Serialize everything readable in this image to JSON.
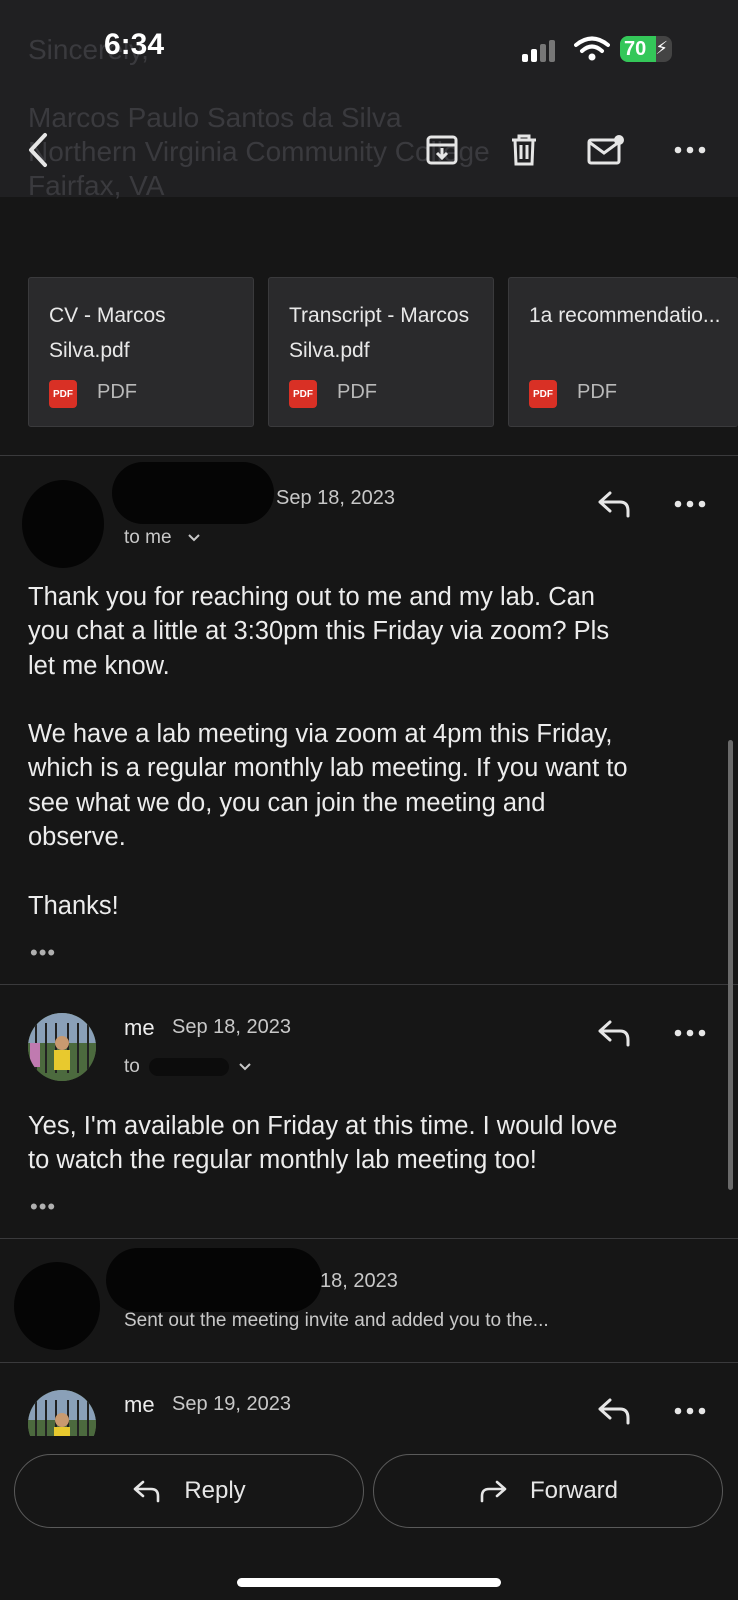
{
  "status_bar": {
    "time": "6:34",
    "battery": "70",
    "battery_level": 0.7
  },
  "header_ghost": {
    "line1": "Sincerely,",
    "line2": "Marcos Paulo Santos da Silva",
    "line3": "Northern Virginia Community College",
    "line4": "Fairfax, VA"
  },
  "toolbar": {
    "icons": [
      "back-icon",
      "archive-icon",
      "trash-icon",
      "mark-unread-icon",
      "more-icon"
    ]
  },
  "attachments": [
    {
      "name": "CV - Marcos Silva.pdf",
      "type": "PDF",
      "badge": "PDF"
    },
    {
      "name": "Transcript - Marcos Silva.pdf",
      "type": "PDF",
      "badge": "PDF"
    },
    {
      "name": "1a recommendatio...",
      "type": "PDF",
      "badge": "PDF"
    }
  ],
  "messages": [
    {
      "date": "Sep 18, 2023",
      "recipient": "to me",
      "body": "Thank you for reaching out to me and my lab. Can\nyou chat a little at 3:30pm this Friday via zoom? Pls\nlet me know.\n\nWe have a lab meeting via zoom at 4pm this Friday,\nwhich is a regular monthly lab meeting. If you want to\nsee what we do, you can join the meeting and\nobserve.\n\nThanks!",
      "ellipsis": "•••"
    },
    {
      "sender": "me",
      "date": "Sep 18, 2023",
      "recipient": "to",
      "body": "Yes, I'm available on Friday at this time. I would love\nto watch the regular monthly lab meeting too!",
      "ellipsis": "•••"
    },
    {
      "date": "18, 2023",
      "snippet": "Sent out the meeting invite and added you to the..."
    },
    {
      "sender": "me",
      "date": "Sep 19, 2023"
    }
  ],
  "actions": {
    "reply": "Reply",
    "forward": "Forward"
  }
}
